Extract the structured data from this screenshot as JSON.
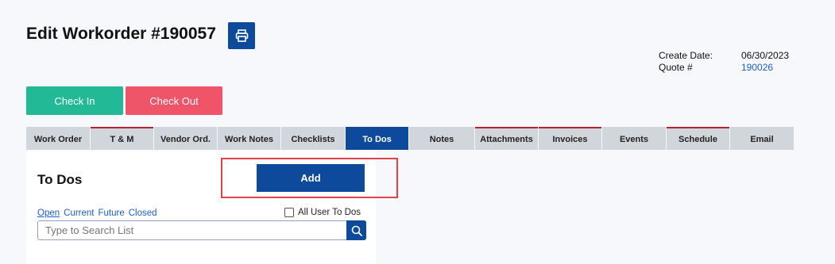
{
  "page": {
    "title": "Edit Workorder #190057"
  },
  "meta": {
    "create_date_label": "Create Date:",
    "create_date_value": "06/30/2023",
    "quote_label": "Quote #",
    "quote_value": "190026"
  },
  "actions": {
    "check_in": "Check In",
    "check_out": "Check Out"
  },
  "tabs": [
    {
      "label": "Work Order"
    },
    {
      "label": "T & M"
    },
    {
      "label": "Vendor Ord."
    },
    {
      "label": "Work Notes"
    },
    {
      "label": "Checklists"
    },
    {
      "label": "To Dos"
    },
    {
      "label": "Notes"
    },
    {
      "label": "Attachments"
    },
    {
      "label": "Invoices"
    },
    {
      "label": "Events"
    },
    {
      "label": "Schedule"
    },
    {
      "label": "Email"
    }
  ],
  "todos": {
    "title": "To Dos",
    "add_label": "Add",
    "filters": [
      "Open",
      "Current",
      "Future",
      "Closed"
    ],
    "all_user_label": "All User To Dos",
    "search_placeholder": "Type to Search List"
  },
  "colors": {
    "primary": "#0d4a9c",
    "check_in": "#22b996",
    "check_out": "#f05468",
    "link": "#1a5fd0",
    "highlight": "#e0424b"
  }
}
